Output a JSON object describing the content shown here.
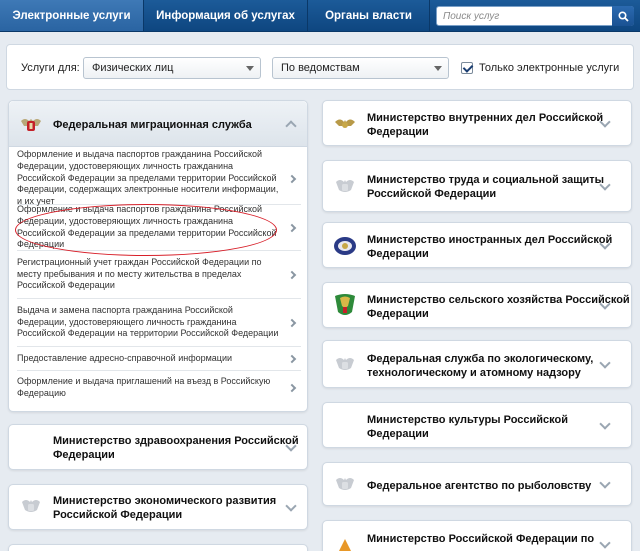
{
  "nav": {
    "tabs": [
      "Электронные услуги",
      "Информация об услугах",
      "Органы власти"
    ],
    "search_placeholder": "Поиск услуг"
  },
  "filter": {
    "label": "Услуги для:",
    "audience": "Физических лиц",
    "grouping": "По ведомствам",
    "only_electronic_label": "Только электронные услуги",
    "only_electronic_checked": true
  },
  "fms": {
    "title": "Федеральная миграционная служба",
    "services": [
      "Оформление и выдача паспортов гражданина Российской Федерации, удостоверяющих личность гражданина Российской Федерации за пределами территории Российской Федерации, содержащих электронные носители информации, и их учет",
      "Оформление и выдача паспортов гражданина Российской Федерации, удостоверяющих личность гражданина Российской Федерации за пределами территории Российской Федерации",
      "Регистрационный учет граждан Российской Федерации по месту пребывания и по месту жительства в пределах Российской Федерации",
      "Выдача и замена паспорта гражданина Российской Федерации, удостоверяющего личность гражданина Российской Федерации на территории Российской Федерации",
      "Предоставление адресно-справочной информации",
      "Оформление и выдача приглашений на въезд в Российскую Федерацию"
    ]
  },
  "left_agencies": [
    "Министерство здравоохранения Российской Федерации",
    "Министерство экономического развития Российской Федерации"
  ],
  "right_agencies": [
    "Министерство внутренних дел Российской Федерации",
    "Министерство труда и социальной защиты Российской Федерации",
    "Министерство иностранных дел Российской Федерации",
    "Министерство сельского хозяйства Российской Федерации",
    "Федеральная служба по экологическому, технологическому и атомному надзору",
    "Министерство культуры Российской Федерации",
    "Федеральное агентство по рыболовству",
    "Министерство Российской Федерации по"
  ]
}
